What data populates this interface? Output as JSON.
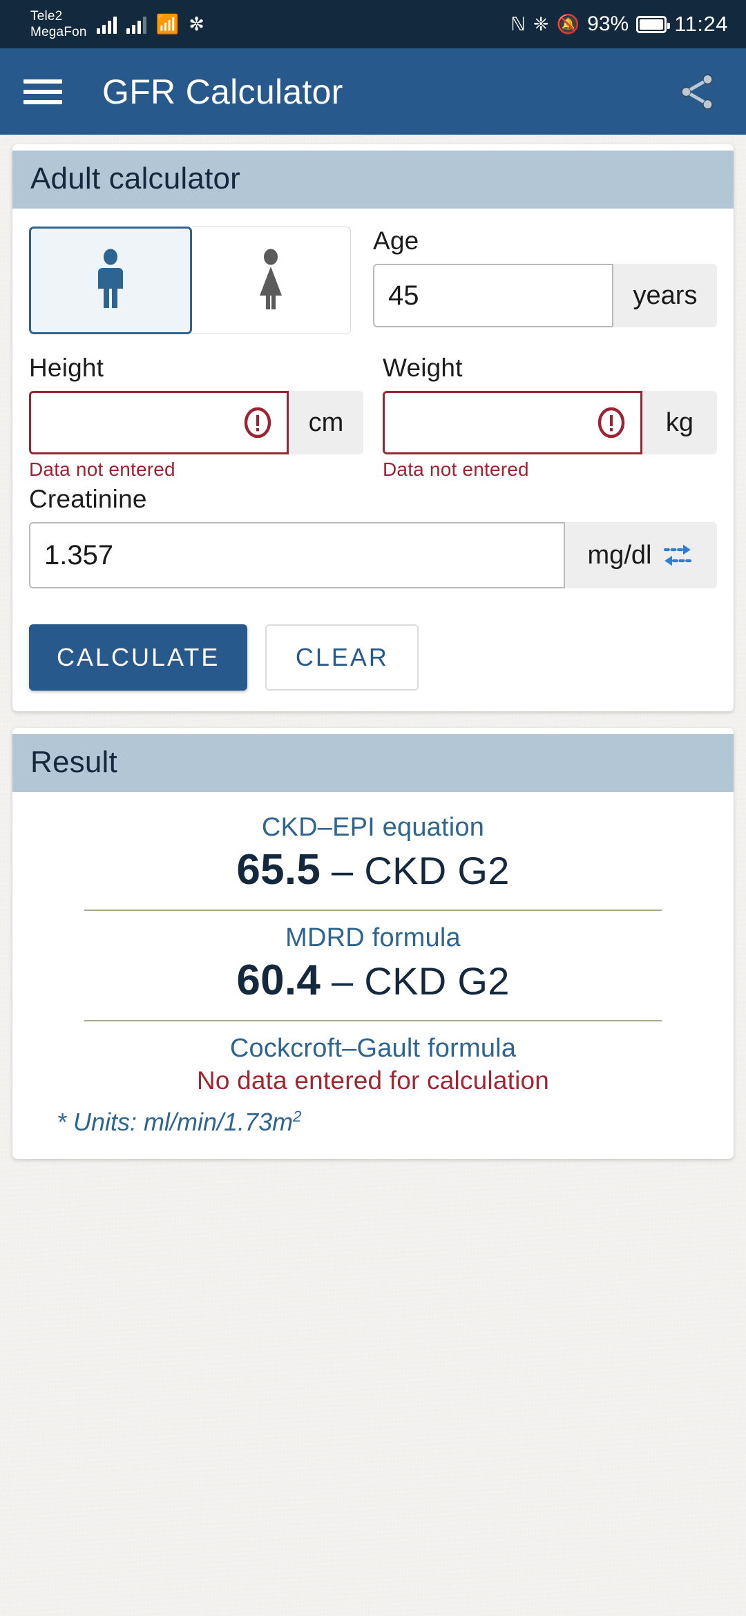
{
  "status_bar": {
    "carrier_1": "Tele2",
    "carrier_2": "MegaFon",
    "nfc_icon": "nfc-icon",
    "bluetooth_icon": "bluetooth-icon",
    "mute_icon": "mute-icon",
    "battery_percent": "93%",
    "clock": "11:24"
  },
  "app_bar": {
    "menu_icon": "hamburger-menu-icon",
    "title": "GFR Calculator",
    "share_icon": "share-icon",
    "background_color": "#28598c"
  },
  "calculator_card": {
    "header": "Adult calculator",
    "gender": {
      "male_label": "male",
      "female_label": "female",
      "selected": "male"
    },
    "age": {
      "label": "Age",
      "value": "45",
      "unit": "years",
      "placeholder": ""
    },
    "height": {
      "label": "Height",
      "value": "",
      "unit": "cm",
      "error": "Data not entered",
      "placeholder": ""
    },
    "weight": {
      "label": "Weight",
      "value": "",
      "unit": "kg",
      "error": "Data not entered",
      "placeholder": ""
    },
    "creatinine": {
      "label": "Creatinine",
      "value": "1.357",
      "unit": "mg/dl",
      "convert_icon": "swap-units-icon",
      "placeholder": ""
    },
    "buttons": {
      "calculate": "CALCULATE",
      "clear": "CLEAR"
    }
  },
  "result_card": {
    "header": "Result",
    "entries": [
      {
        "title": "CKD–EPI equation",
        "value": "65.5",
        "separator": " – ",
        "stage": "CKD G2",
        "error": ""
      },
      {
        "title": "MDRD formula",
        "value": "60.4",
        "separator": " – ",
        "stage": "CKD G2",
        "error": ""
      },
      {
        "title": "Cockcroft–Gault formula",
        "value": "",
        "separator": "",
        "stage": "",
        "error": "No data entered for calculation"
      }
    ],
    "units_note_prefix": "* Units: ml/min/1.73m",
    "units_note_sup": "2"
  },
  "colors": {
    "primary": "#28598c",
    "card_header": "#b3c6d5",
    "error": "#9e2330",
    "accent_text": "#2d6590"
  }
}
